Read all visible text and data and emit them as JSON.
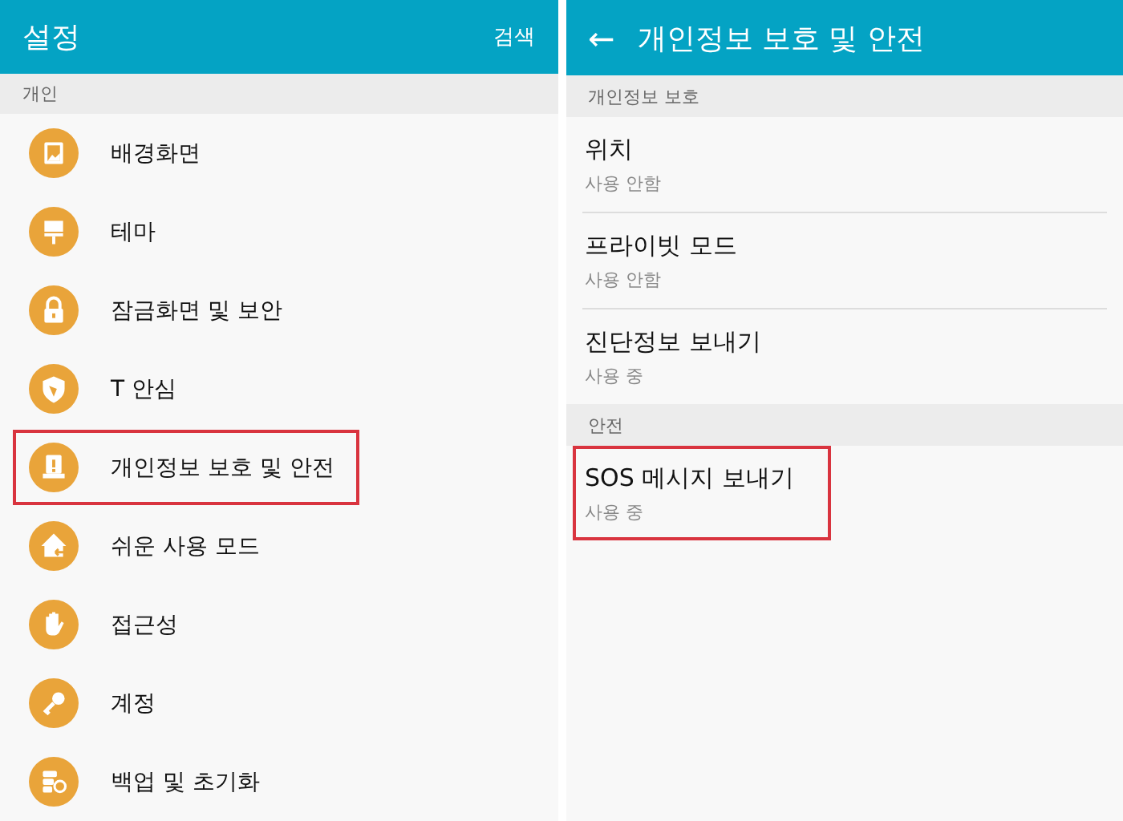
{
  "left": {
    "title": "설정",
    "action": "검색",
    "section": "개인",
    "items": [
      {
        "label": "배경화면",
        "highlighted": false
      },
      {
        "label": "테마",
        "highlighted": false
      },
      {
        "label": "잠금화면 및 보안",
        "highlighted": false
      },
      {
        "label": "T 안심",
        "highlighted": false
      },
      {
        "label": "개인정보 보호 및 안전",
        "highlighted": true
      },
      {
        "label": "쉬운 사용 모드",
        "highlighted": false
      },
      {
        "label": "접근성",
        "highlighted": false
      },
      {
        "label": "계정",
        "highlighted": false
      },
      {
        "label": "백업 및 초기화",
        "highlighted": false
      }
    ]
  },
  "right": {
    "back": "←",
    "title": "개인정보 보호 및 안전",
    "sections": [
      {
        "header": "개인정보 보호",
        "items": [
          {
            "title": "위치",
            "status": "사용 안함",
            "highlighted": false
          },
          {
            "title": "프라이빗 모드",
            "status": "사용 안함",
            "highlighted": false
          },
          {
            "title": "진단정보 보내기",
            "status": "사용 중",
            "highlighted": false
          }
        ]
      },
      {
        "header": "안전",
        "items": [
          {
            "title": "SOS 메시지 보내기",
            "status": "사용 중",
            "highlighted": true
          }
        ]
      }
    ]
  }
}
